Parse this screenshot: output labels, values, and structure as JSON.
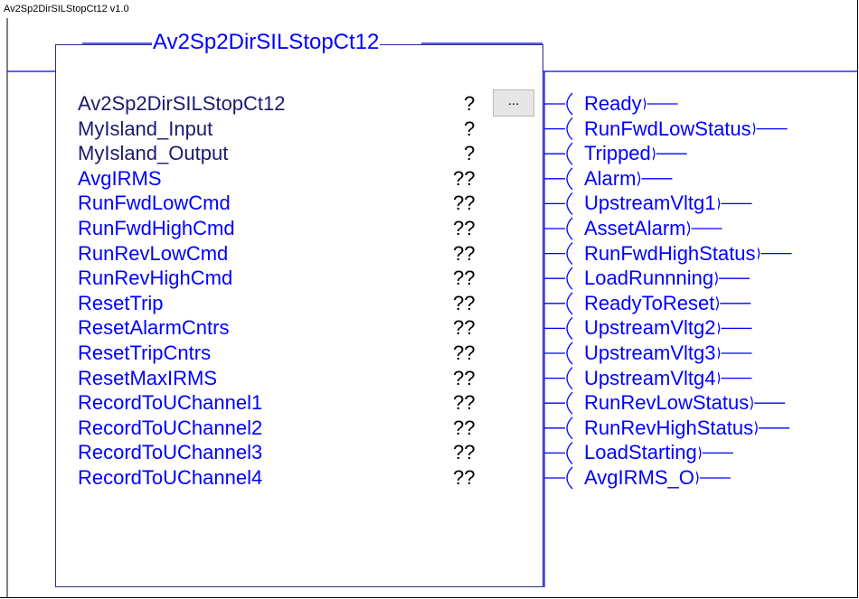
{
  "instruction": {
    "version_label": "Av2Sp2DirSILStopCt12 v1.0",
    "block_title": "Av2Sp2DirSILStopCt12",
    "browse_button_label": "..."
  },
  "parameters": [
    {
      "name": "Av2Sp2DirSILStopCt12",
      "value": "?",
      "style": "dark"
    },
    {
      "name": "MyIsland_Input",
      "value": "?",
      "style": "dark"
    },
    {
      "name": "MyIsland_Output",
      "value": "?",
      "style": "dark"
    },
    {
      "name": "AvgIRMS",
      "value": "??",
      "style": "blue"
    },
    {
      "name": "RunFwdLowCmd",
      "value": "??",
      "style": "blue"
    },
    {
      "name": "RunFwdHighCmd",
      "value": "??",
      "style": "blue"
    },
    {
      "name": "RunRevLowCmd",
      "value": "??",
      "style": "blue"
    },
    {
      "name": "RunRevHighCmd",
      "value": "??",
      "style": "blue"
    },
    {
      "name": "ResetTrip",
      "value": "??",
      "style": "blue"
    },
    {
      "name": "ResetAlarmCntrs",
      "value": "??",
      "style": "blue"
    },
    {
      "name": "ResetTripCntrs",
      "value": "??",
      "style": "blue"
    },
    {
      "name": "ResetMaxIRMS",
      "value": "??",
      "style": "blue"
    },
    {
      "name": "RecordToUChannel1",
      "value": "??",
      "style": "blue"
    },
    {
      "name": "RecordToUChannel2",
      "value": "??",
      "style": "blue"
    },
    {
      "name": "RecordToUChannel3",
      "value": "??",
      "style": "blue"
    },
    {
      "name": "RecordToUChannel4",
      "value": "??",
      "style": "blue"
    }
  ],
  "outputs": [
    "Ready",
    "RunFwdLowStatus",
    "Tripped",
    "Alarm",
    "UpstreamVltg1",
    "AssetAlarm",
    "RunFwdHighStatus",
    "LoadRunnning",
    "ReadyToReset",
    "UpstreamVltg2",
    "UpstreamVltg3",
    "UpstreamVltg4",
    "RunRevLowStatus",
    "RunRevHighStatus",
    "LoadStarting",
    "AvgIRMS_O"
  ],
  "colors": {
    "param_dark": "#1b1b6e",
    "param_blue": "#0000ff",
    "wire": "#0000ff",
    "block_border": "#2b2b8c"
  }
}
